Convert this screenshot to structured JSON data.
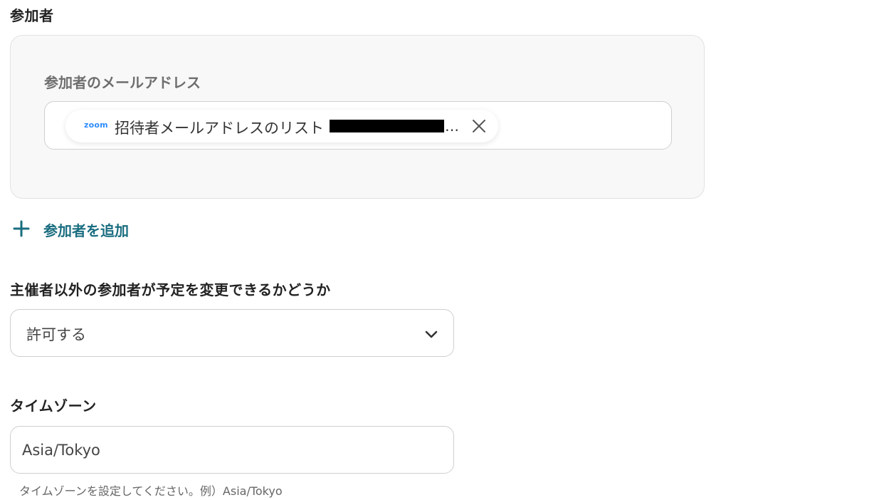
{
  "participants": {
    "title": "参加者",
    "email_label": "参加者のメールアドレス",
    "chip": {
      "logo_text": "zoom",
      "text": "招待者メールアドレスのリスト",
      "ellipsis": "…"
    },
    "add_label": "参加者を追加"
  },
  "guest_modify": {
    "title": "主催者以外の参加者が予定を変更できるかどうか",
    "selected": "許可する"
  },
  "timezone": {
    "title": "タイムゾーン",
    "value": "Asia/Tokyo",
    "helper": "タイムゾーンを設定してください。例）Asia/Tokyo"
  },
  "colors": {
    "accent": "#1a6d80",
    "zoom_brand": "#2d8cff",
    "card_bg": "#f8f8f8",
    "border": "#cfcfcf"
  },
  "icons": {
    "chip_close": "close-icon",
    "add": "plus-icon",
    "select": "chevron-down-icon",
    "logo": "zoom-logo-icon"
  }
}
